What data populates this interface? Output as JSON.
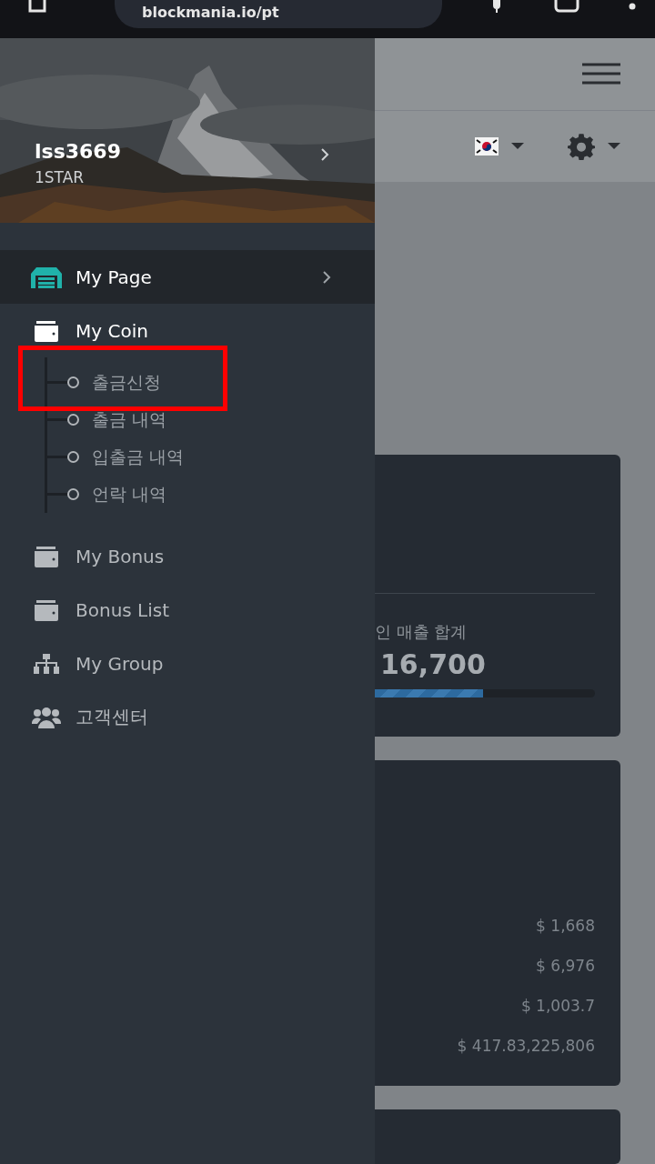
{
  "browser": {
    "url": "blockmania.io/pt"
  },
  "sidebar": {
    "user": {
      "name": "lss3669",
      "rank": "1STAR"
    },
    "items": [
      {
        "kind": "page",
        "label": "My Page",
        "selected": true,
        "expanded": false
      },
      {
        "kind": "wallet",
        "label": "My Coin",
        "selected": false,
        "expanded": true,
        "children": [
          {
            "label": "출금신청",
            "highlighted": true
          },
          {
            "label": "출금 내역",
            "highlighted": false
          },
          {
            "label": "입출금 내역",
            "highlighted": false
          },
          {
            "label": "언락 내역",
            "highlighted": false
          }
        ]
      },
      {
        "kind": "wallet",
        "label": "My Bonus",
        "selected": false,
        "expanded": false
      },
      {
        "kind": "wallet",
        "label": "Bonus List",
        "selected": false,
        "expanded": false
      },
      {
        "kind": "group",
        "label": "My Group",
        "selected": false,
        "expanded": false
      },
      {
        "kind": "users",
        "label": "고객센터",
        "selected": false,
        "expanded": false
      }
    ]
  },
  "cards": [
    {
      "kind": "sales",
      "label": "인 매출 합계",
      "value": "16,700",
      "level": 0.49
    },
    {
      "kind": "amounts",
      "values": [
        "$ 1,668",
        "$ 6,976",
        "$ 1,003.7",
        "$ 417.83,225,806"
      ]
    },
    {
      "kind": "empty"
    }
  ]
}
